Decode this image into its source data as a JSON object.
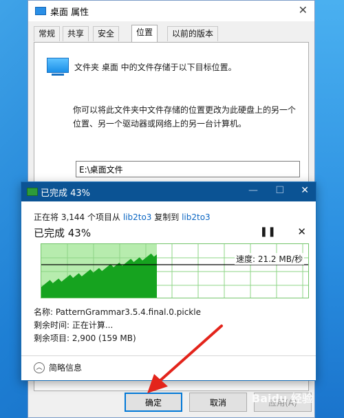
{
  "properties": {
    "title": "桌面 属性",
    "tabs": [
      "常规",
      "共享",
      "安全",
      "位置",
      "以前的版本"
    ],
    "active_tab": "位置",
    "line1": "文件夹 桌面 中的文件存储于以下目标位置。",
    "desc": "你可以将此文件夹中文件存储的位置更改为此硬盘上的另一个位置、另一个驱动器或网络上的另一台计算机。",
    "path": "E:\\桌面文件",
    "ok_label": "确定",
    "cancel_label": "取消",
    "apply_label": "应用(A)"
  },
  "copy_dialog": {
    "title": "已完成 43%",
    "summary_prefix": "正在将 3,144 个项目从 ",
    "source": "lib2to3",
    "summary_mid": " 复制到 ",
    "dest": "lib2to3",
    "percent_label": "已完成 43%",
    "progress_fraction": 0.43,
    "speed_label": "速度: 21.2 MB/秒",
    "name_line": "名称: PatternGrammar3.5.4.final.0.pickle",
    "remaining_time": "剩余时间: 正在计算...",
    "remaining_items": "剩余项目: 2,900 (159 MB)",
    "less_details": "简略信息"
  },
  "watermark": "Baidu 经验",
  "colors": {
    "titlebar": "#0b5394",
    "graph_fill": "#b7ecae",
    "graph_area": "#16a31f",
    "link": "#0b66c3",
    "arrow": "#e3241b"
  }
}
